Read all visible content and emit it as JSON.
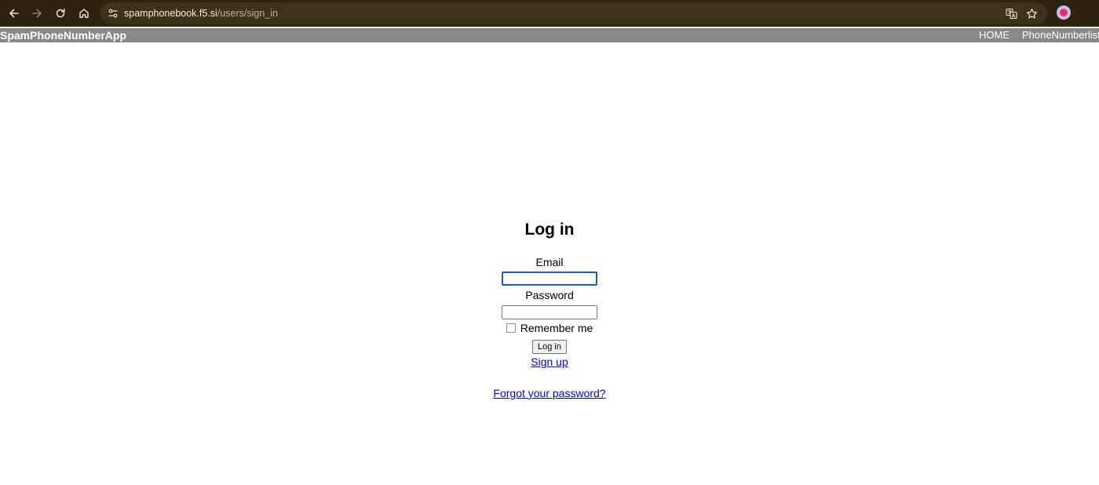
{
  "browser": {
    "url_host": "spamphonebook.f5.si",
    "url_path": "/users/sign_in",
    "icons": {
      "back": "arrow-left-icon",
      "forward": "arrow-right-icon",
      "reload": "reload-icon",
      "home": "home-icon",
      "site_info": "tune-icon",
      "translate": "translate-icon",
      "bookmark": "star-icon",
      "profile": "avatar",
      "menu": "kebab-menu-icon"
    },
    "colors": {
      "toolbar_bg": "#2e230f",
      "omnibox_bg": "#3e3218"
    }
  },
  "navbar": {
    "brand": "SpamPhoneNumberApp",
    "links": [
      "HOME",
      "PhoneNumberlist"
    ],
    "bg_color": "#888888"
  },
  "login": {
    "title": "Log in",
    "email_label": "Email",
    "email_value": "",
    "password_label": "Password",
    "password_value": "",
    "remember_label": "Remember me",
    "remember_checked": false,
    "submit_label": "Log in",
    "signup_link": "Sign up",
    "forgot_link": "Forgot your password?",
    "link_color": "#0000ee"
  }
}
